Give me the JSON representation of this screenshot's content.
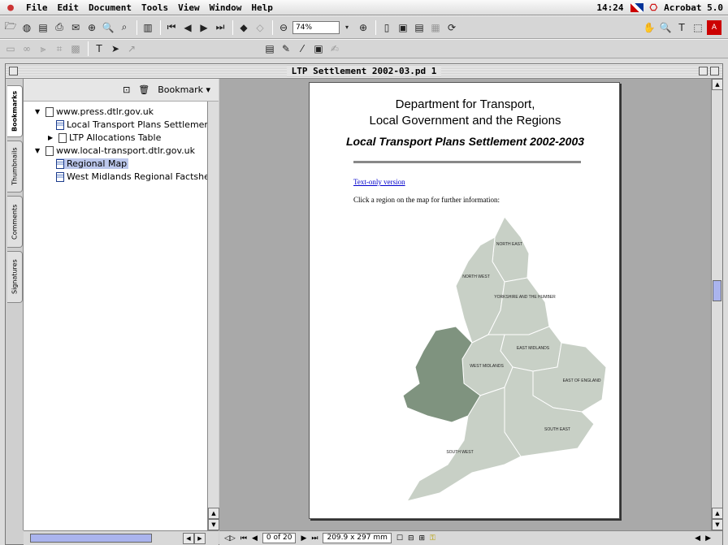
{
  "menubar": {
    "apple": "🍏",
    "items": [
      "File",
      "Edit",
      "Document",
      "Tools",
      "View",
      "Window",
      "Help"
    ],
    "time": "14:24",
    "app": "Acrobat 5.0"
  },
  "toolbar": {
    "zoom": "74%"
  },
  "window": {
    "title": "LTP Settlement 2002-03.pd 1"
  },
  "nav": {
    "bookmark_menu": "Bookmark ▾",
    "tabs": [
      "Bookmarks",
      "Thumbnails",
      "Comments",
      "Signatures"
    ],
    "items": [
      {
        "label": "www.press.dtlr.gov.uk",
        "level": 0,
        "expanded": true
      },
      {
        "label": "Local Transport Plans Settlement",
        "level": 1
      },
      {
        "label": "LTP Allocations Table",
        "level": 1,
        "collapsed": true
      },
      {
        "label": "www.local-transport.dtlr.gov.uk",
        "level": 0,
        "expanded": true
      },
      {
        "label": "Regional Map",
        "level": 1,
        "selected": true
      },
      {
        "label": "West Midlands Regional Factshee",
        "level": 1
      }
    ]
  },
  "page": {
    "heading1": "Department for Transport,",
    "heading2": "Local Government and the Regions",
    "subtitle": "Local Transport Plans Settlement 2002-2003",
    "link": "Text-only version",
    "instruction": "Click a region on the map for further information:",
    "regions": [
      "NORTH EAST",
      "NORTH WEST",
      "YORKSHIRE AND THE HUMBER",
      "EAST MIDLANDS",
      "WEST MIDLANDS",
      "EAST OF ENGLAND",
      "SOUTH EAST",
      "SOUTH WEST"
    ]
  },
  "status": {
    "page": "0 of 20",
    "size": "209.9 x 297 mm"
  }
}
